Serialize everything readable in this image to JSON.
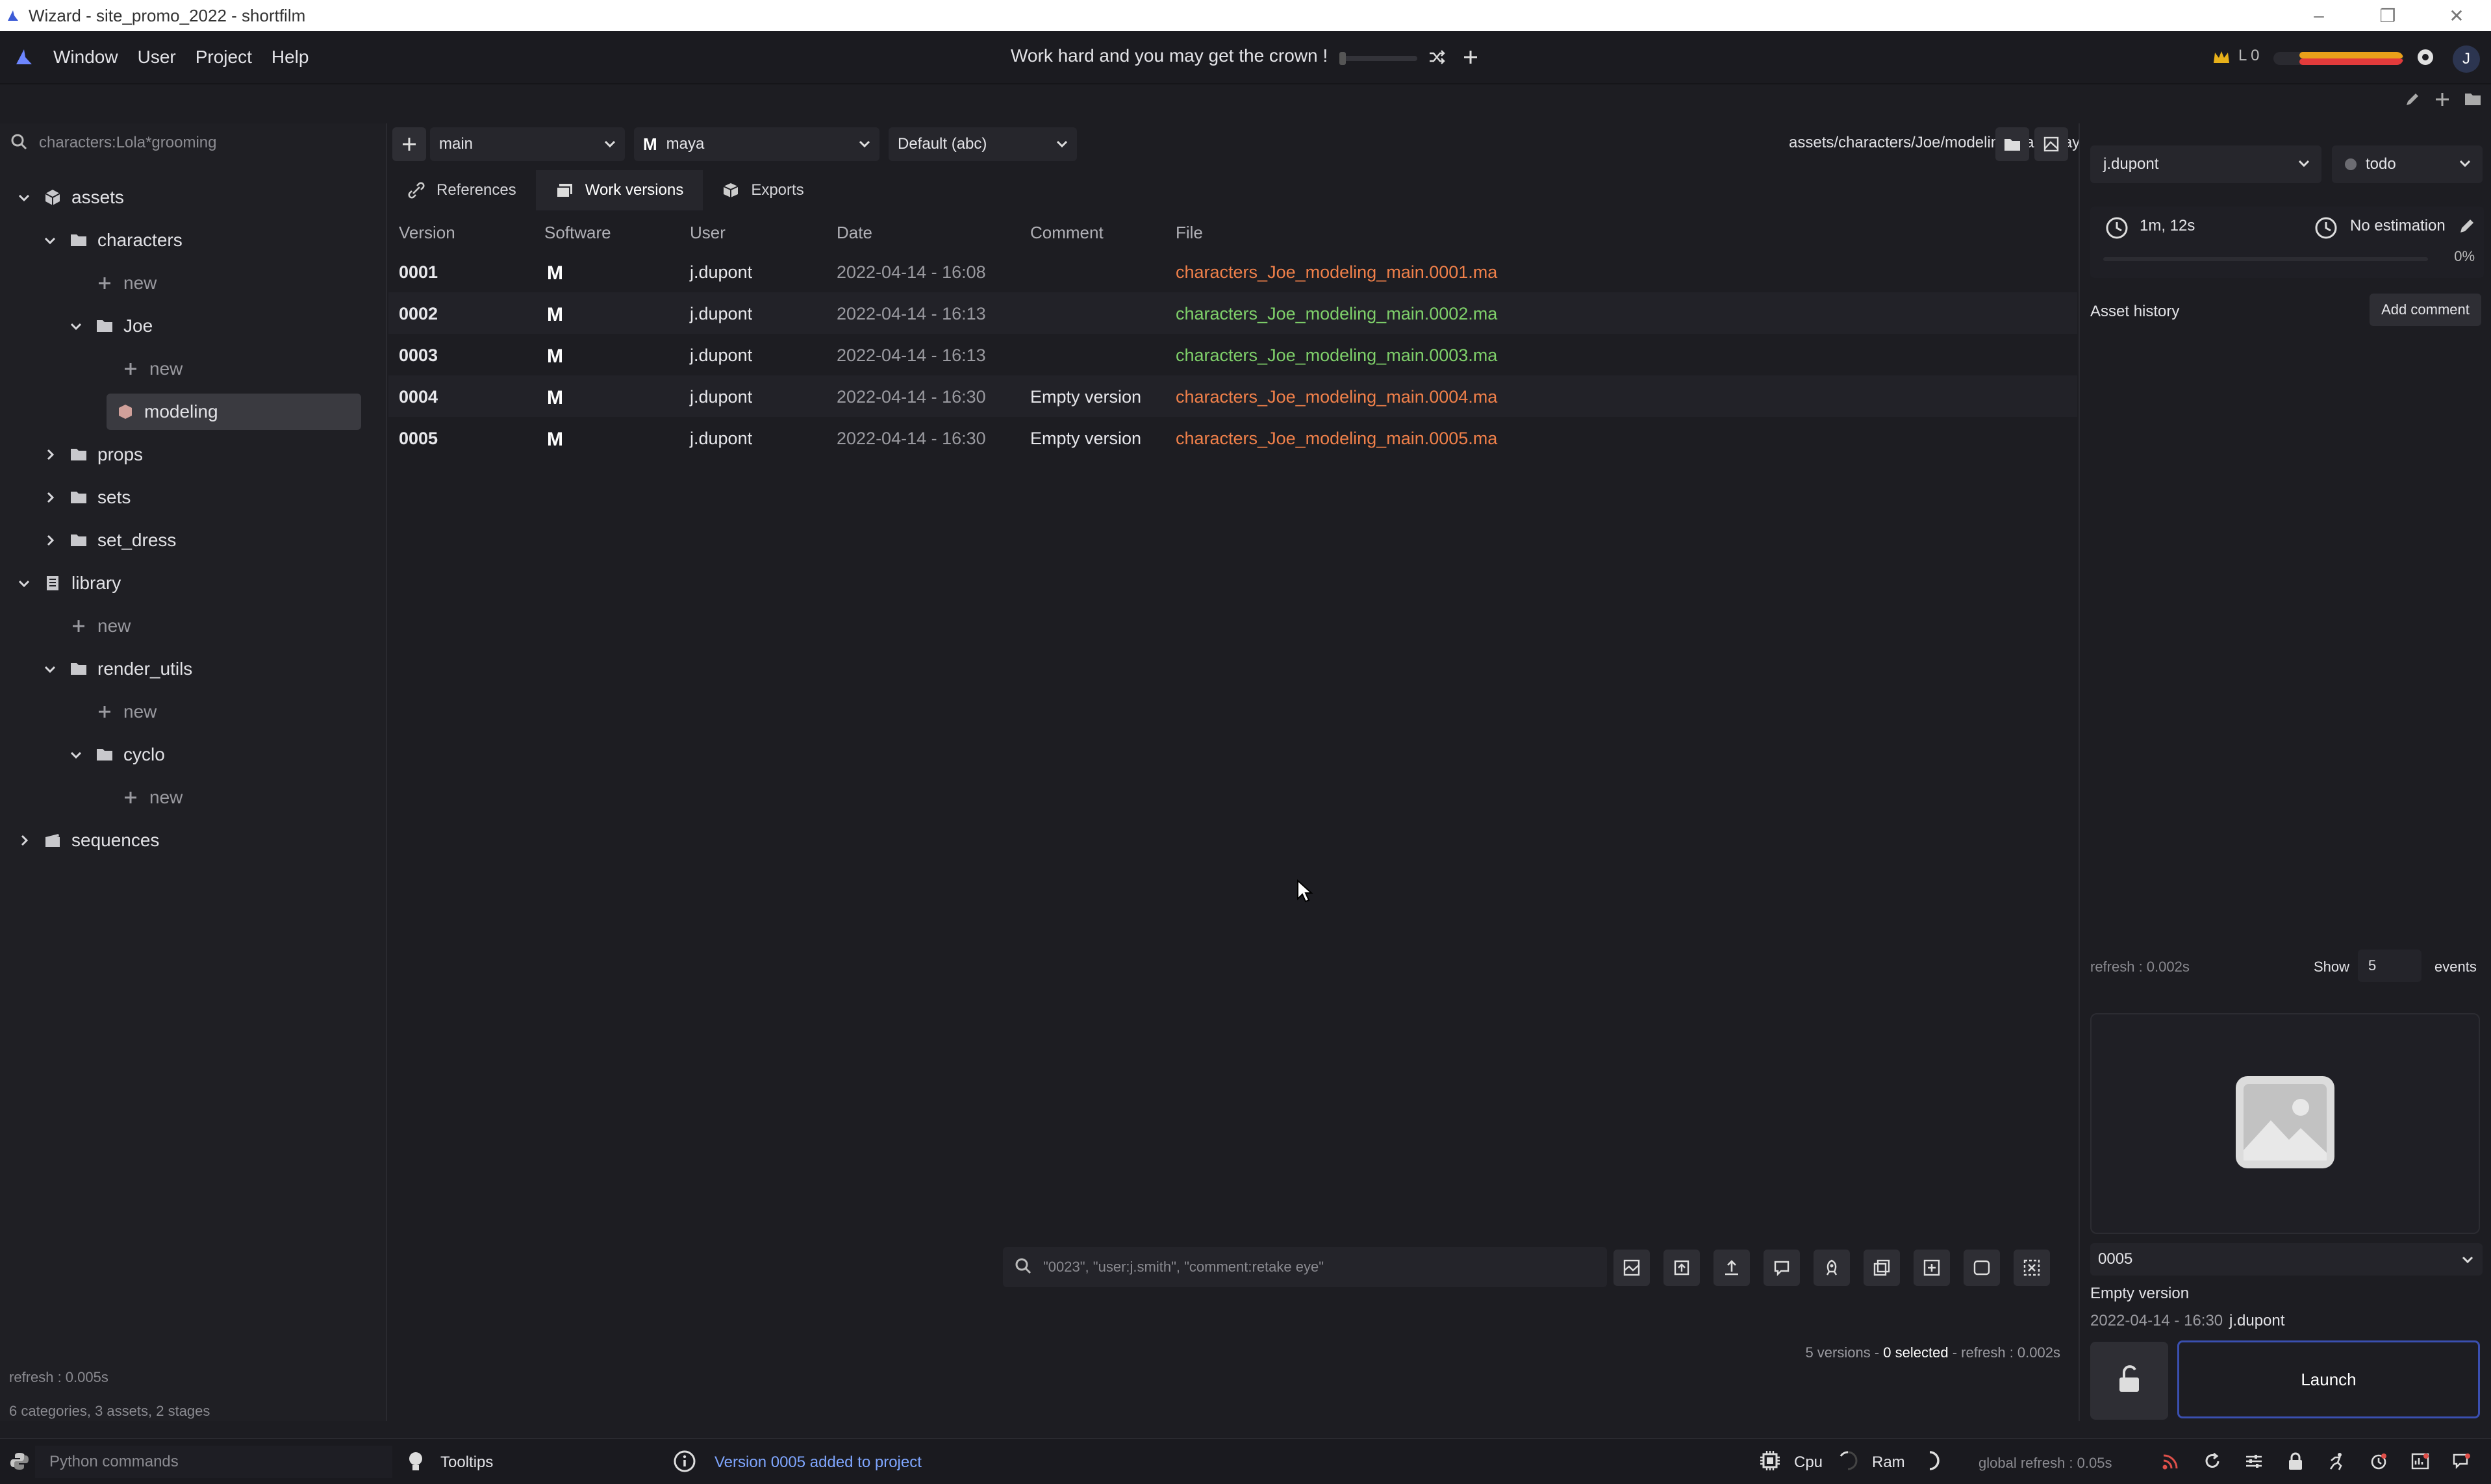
{
  "window": {
    "title": "Wizard - site_promo_2022 - shortfilm",
    "controls": [
      "minimize",
      "restore",
      "close"
    ]
  },
  "menubar": {
    "items": [
      "Window",
      "User",
      "Project",
      "Help"
    ],
    "motd": "Work hard and you may get the crown !",
    "level_label": "L 0",
    "avatar_initial": "J"
  },
  "tree": {
    "search_placeholder": "characters:Lola*grooming",
    "nodes": [
      {
        "label": "assets",
        "icon": "assets-icon",
        "expanded": true
      },
      {
        "label": "characters",
        "icon": "folder-icon",
        "expanded": true
      },
      {
        "label": "new",
        "icon": "plus-icon"
      },
      {
        "label": "Joe",
        "icon": "folder-icon",
        "expanded": true
      },
      {
        "label": "new",
        "icon": "plus-icon"
      },
      {
        "label": "modeling",
        "icon": "stage-icon",
        "selected": true
      },
      {
        "label": "props",
        "icon": "folder-icon",
        "expanded": false
      },
      {
        "label": "sets",
        "icon": "folder-icon",
        "expanded": false
      },
      {
        "label": "set_dress",
        "icon": "folder-icon",
        "expanded": false
      },
      {
        "label": "library",
        "icon": "library-icon",
        "expanded": true
      },
      {
        "label": "new",
        "icon": "plus-icon"
      },
      {
        "label": "render_utils",
        "icon": "folder-icon",
        "expanded": true
      },
      {
        "label": "new",
        "icon": "plus-icon"
      },
      {
        "label": "cyclo",
        "icon": "folder-icon",
        "expanded": true
      },
      {
        "label": "new",
        "icon": "plus-icon"
      },
      {
        "label": "sequences",
        "icon": "sequences-icon",
        "expanded": false
      }
    ],
    "footer_refresh": "refresh : 0.005s",
    "footer_stats": "6 categories, 3 assets, 2 stages"
  },
  "center": {
    "variant": "main",
    "software": "maya",
    "export_format": "Default (abc)",
    "path": "assets/characters/Joe/modeling/main/maya",
    "tabs": [
      {
        "label": "References",
        "active": false
      },
      {
        "label": "Work versions",
        "active": true
      },
      {
        "label": "Exports",
        "active": false
      }
    ],
    "columns": [
      "Version",
      "Software",
      "User",
      "Date",
      "Comment",
      "File"
    ],
    "rows": [
      {
        "version": "0001",
        "software": "M",
        "user": "j.dupont",
        "date": "2022-04-14 - 16:08",
        "comment": "",
        "file": "characters_Joe_modeling_main.0001.ma",
        "file_color": "#f0804a"
      },
      {
        "version": "0002",
        "software": "M",
        "user": "j.dupont",
        "date": "2022-04-14 - 16:13",
        "comment": "",
        "file": "characters_Joe_modeling_main.0002.ma",
        "file_color": "#7fd06a"
      },
      {
        "version": "0003",
        "software": "M",
        "user": "j.dupont",
        "date": "2022-04-14 - 16:13",
        "comment": "",
        "file": "characters_Joe_modeling_main.0003.ma",
        "file_color": "#7fd06a"
      },
      {
        "version": "0004",
        "software": "M",
        "user": "j.dupont",
        "date": "2022-04-14 - 16:30",
        "comment": "Empty version",
        "file": "characters_Joe_modeling_main.0004.ma",
        "file_color": "#f0804a"
      },
      {
        "version": "0005",
        "software": "M",
        "user": "j.dupont",
        "date": "2022-04-14 - 16:30",
        "comment": "Empty version",
        "file": "characters_Joe_modeling_main.0005.ma",
        "file_color": "#f0804a"
      }
    ],
    "summary_versions": "5 versions - ",
    "summary_selected": "0 selected",
    "summary_refresh": " - refresh : 0.002s",
    "search_placeholder": "\"0023\", \"user:j.smith\", \"comment:retake eye\""
  },
  "right": {
    "user": "j.dupont",
    "state": "todo",
    "work_time": "1m, 12s",
    "estimation": "No estimation",
    "progress_percent": "0%",
    "history_label": "Asset history",
    "add_comment": "Add comment",
    "refresh": "refresh : 0.002s",
    "show_label": "Show",
    "show_value": "5",
    "events_label": "events",
    "selected_version": "0005",
    "version_comment": "Empty version",
    "version_date": "2022-04-14 - 16:30",
    "version_user": "j.dupont",
    "launch_label": "Launch"
  },
  "statusbar": {
    "python_placeholder": "Python commands",
    "tooltips_label": "Tooltips",
    "message": "Version 0005 added to project",
    "cpu_label": "Cpu",
    "ram_label": "Ram",
    "global_refresh": "global refresh : 0.05s"
  },
  "colors": {
    "accent_blue": "#3a4fb0",
    "file_orange": "#f0804a",
    "file_green": "#7fd06a",
    "message_blue": "#7fa6ff"
  }
}
